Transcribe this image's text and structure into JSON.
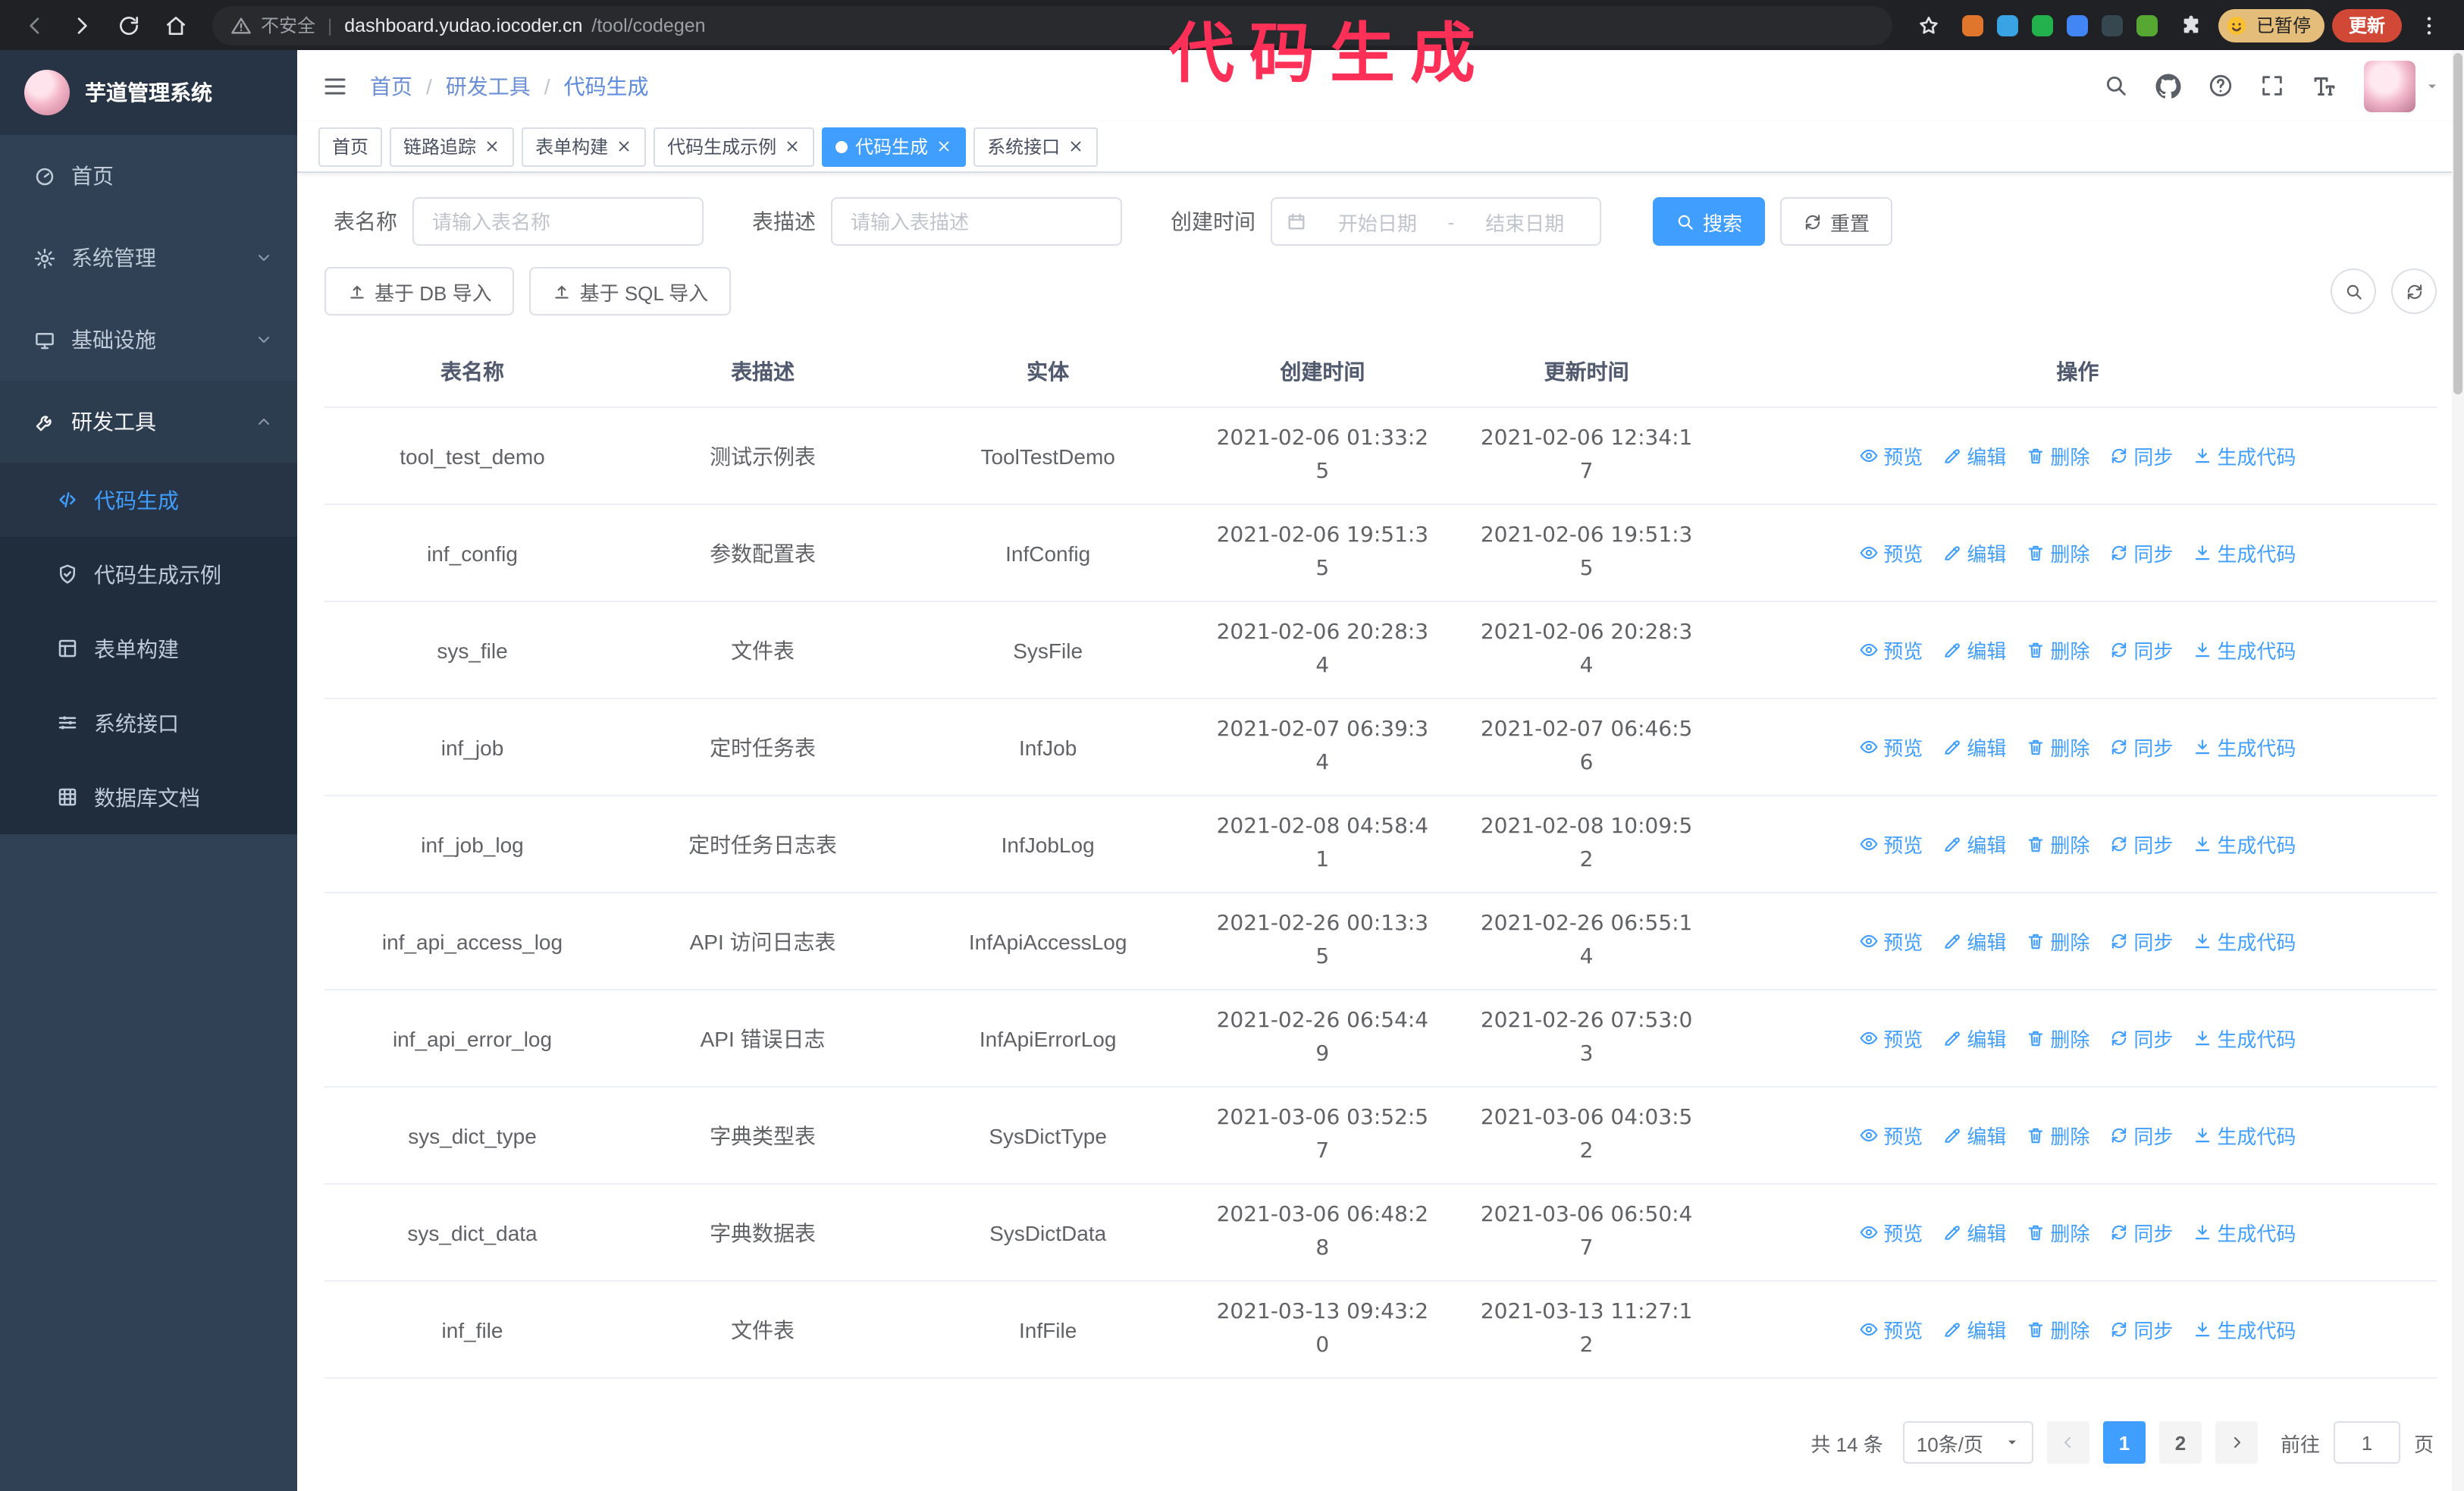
{
  "annotation": "代码生成",
  "browser": {
    "security_warning": "不安全",
    "url_divider": "|",
    "url_host": "dashboard.yudao.iocoder.cn",
    "url_path": "/tool/codegen",
    "profile_badge": "已暂停",
    "update_button": "更新",
    "extension_colors": [
      "#e0752c",
      "#3aa3e3",
      "#23b14d",
      "#4285f4",
      "#37474f",
      "#57a832"
    ]
  },
  "sidebar": {
    "title": "芋道管理系统",
    "menu": [
      {
        "id": "home",
        "label": "首页",
        "icon": "menu-home"
      },
      {
        "id": "system",
        "label": "系统管理",
        "icon": "gear",
        "chevron": "down"
      },
      {
        "id": "infra",
        "label": "基础设施",
        "icon": "infra",
        "chevron": "down"
      },
      {
        "id": "devtools",
        "label": "研发工具",
        "icon": "tools",
        "chevron": "up",
        "open": true,
        "children": [
          {
            "id": "codegen",
            "label": "代码生成",
            "icon": "code",
            "active": true
          },
          {
            "id": "codegen-example",
            "label": "代码生成示例",
            "icon": "shield"
          },
          {
            "id": "form-builder",
            "label": "表单构建",
            "icon": "form"
          },
          {
            "id": "system-api",
            "label": "系统接口",
            "icon": "api"
          },
          {
            "id": "db-doc",
            "label": "数据库文档",
            "icon": "db"
          }
        ]
      }
    ]
  },
  "header": {
    "breadcrumb": [
      "首页",
      "研发工具",
      "代码生成"
    ],
    "breadcrumb_separator": "/"
  },
  "tabs": [
    {
      "id": "home",
      "label": "首页",
      "closable": false,
      "active": false
    },
    {
      "id": "trace",
      "label": "链路追踪",
      "closable": true,
      "active": false
    },
    {
      "id": "form-builder",
      "label": "表单构建",
      "closable": true,
      "active": false
    },
    {
      "id": "codegen-example",
      "label": "代码生成示例",
      "closable": true,
      "active": false
    },
    {
      "id": "codegen",
      "label": "代码生成",
      "closable": true,
      "active": true
    },
    {
      "id": "system-api",
      "label": "系统接口",
      "closable": true,
      "active": false
    }
  ],
  "filters": {
    "table_name_label": "表名称",
    "table_name_placeholder": "请输入表名称",
    "table_desc_label": "表描述",
    "table_desc_placeholder": "请输入表描述",
    "create_time_label": "创建时间",
    "start_date_placeholder": "开始日期",
    "range_separator": "-",
    "end_date_placeholder": "结束日期",
    "search_button": "搜索",
    "reset_button": "重置"
  },
  "toolbar": {
    "import_db_button": "基于 DB 导入",
    "import_sql_button": "基于 SQL 导入"
  },
  "table": {
    "columns": [
      "表名称",
      "表描述",
      "实体",
      "创建时间",
      "更新时间",
      "操作"
    ],
    "actions": [
      {
        "id": "preview",
        "label": "预览",
        "icon": "eye"
      },
      {
        "id": "edit",
        "label": "编辑",
        "icon": "edit"
      },
      {
        "id": "delete",
        "label": "删除",
        "icon": "trash"
      },
      {
        "id": "sync",
        "label": "同步",
        "icon": "sync"
      },
      {
        "id": "generate",
        "label": "生成代码",
        "icon": "download"
      }
    ],
    "rows": [
      {
        "name": "tool_test_demo",
        "desc": "测试示例表",
        "entity": "ToolTestDemo",
        "created": "2021-02-06 01:33:25",
        "updated": "2021-02-06 12:34:17"
      },
      {
        "name": "inf_config",
        "desc": "参数配置表",
        "entity": "InfConfig",
        "created": "2021-02-06 19:51:35",
        "updated": "2021-02-06 19:51:35"
      },
      {
        "name": "sys_file",
        "desc": "文件表",
        "entity": "SysFile",
        "created": "2021-02-06 20:28:34",
        "updated": "2021-02-06 20:28:34"
      },
      {
        "name": "inf_job",
        "desc": "定时任务表",
        "entity": "InfJob",
        "created": "2021-02-07 06:39:34",
        "updated": "2021-02-07 06:46:56"
      },
      {
        "name": "inf_job_log",
        "desc": "定时任务日志表",
        "entity": "InfJobLog",
        "created": "2021-02-08 04:58:41",
        "updated": "2021-02-08 10:09:52"
      },
      {
        "name": "inf_api_access_log",
        "desc": "API 访问日志表",
        "entity": "InfApiAccessLog",
        "created": "2021-02-26 00:13:35",
        "updated": "2021-02-26 06:55:14"
      },
      {
        "name": "inf_api_error_log",
        "desc": "API 错误日志",
        "entity": "InfApiErrorLog",
        "created": "2021-02-26 06:54:49",
        "updated": "2021-02-26 07:53:03"
      },
      {
        "name": "sys_dict_type",
        "desc": "字典类型表",
        "entity": "SysDictType",
        "created": "2021-03-06 03:52:57",
        "updated": "2021-03-06 04:03:52"
      },
      {
        "name": "sys_dict_data",
        "desc": "字典数据表",
        "entity": "SysDictData",
        "created": "2021-03-06 06:48:28",
        "updated": "2021-03-06 06:50:47"
      },
      {
        "name": "inf_file",
        "desc": "文件表",
        "entity": "InfFile",
        "created": "2021-03-13 09:43:20",
        "updated": "2021-03-13 11:27:12"
      }
    ]
  },
  "pagination": {
    "total_text": "共 14 条",
    "page_size": "10条/页",
    "pages": [
      "1",
      "2"
    ],
    "active_page": "1",
    "goto_label": "前往",
    "goto_value": "1",
    "goto_unit": "页"
  }
}
